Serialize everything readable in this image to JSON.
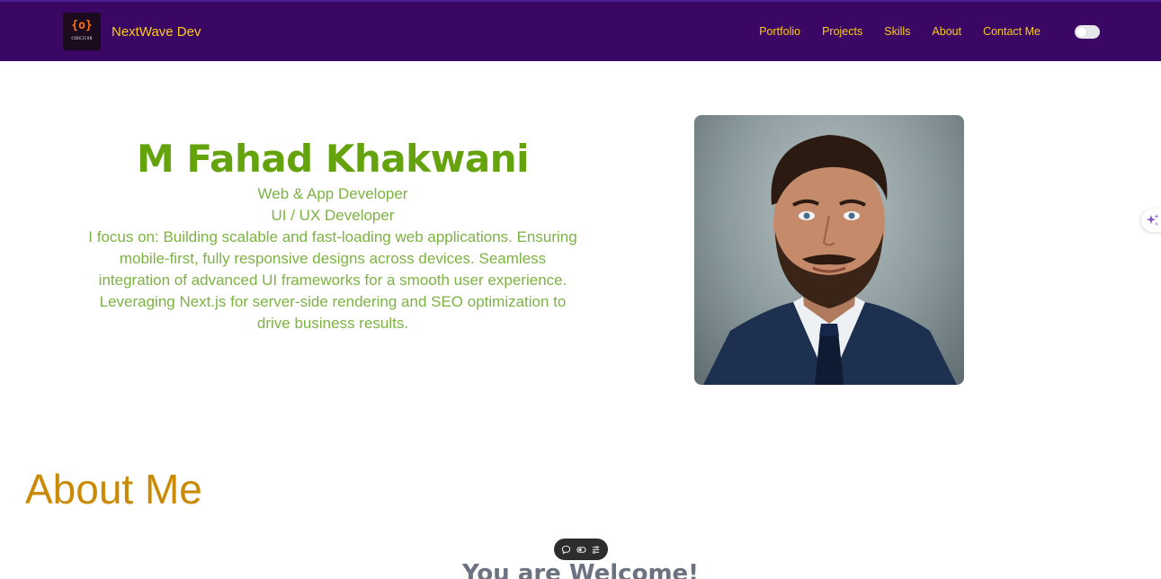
{
  "nav": {
    "brand_name": "NextWave Dev",
    "logo_glyph": "{o}",
    "logo_text": "CODEICON",
    "links": [
      {
        "label": "Portfolio"
      },
      {
        "label": "Projects"
      },
      {
        "label": "Skills"
      },
      {
        "label": "About"
      },
      {
        "label": "Contact Me"
      }
    ],
    "theme_toggle": "toggle-switch"
  },
  "hero": {
    "name": "M Fahad Khakwani",
    "role_1": "Web & App Developer",
    "role_2": "UI / UX Developer",
    "description": "I focus on: Building scalable and fast-loading web applications. Ensuring mobile-first, fully responsive designs across devices. Seamless integration of advanced UI frameworks for a smooth user experience. Leveraging Next.js for server-side rendering and SEO optimization to drive business results."
  },
  "about": {
    "heading": "About Me",
    "welcome": "You are Welcome!"
  },
  "floating_toolbar": {
    "icons": [
      "chat-bubble-icon",
      "contrast-icon",
      "sliders-icon"
    ]
  },
  "colors": {
    "nav_bg": "#3b0764",
    "nav_text": "#facc15",
    "hero_name": "#65a30d",
    "hero_text": "#7cb342",
    "about_heading": "#ca8a04",
    "welcome": "#6b7280"
  }
}
